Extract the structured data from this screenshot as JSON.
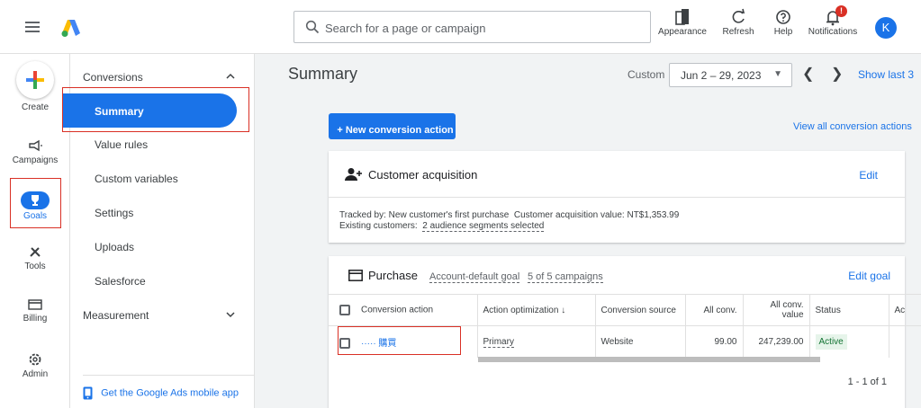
{
  "header": {
    "search_placeholder": "Search for a page or campaign",
    "tools": [
      {
        "label": "Appearance",
        "icon": "appearance-icon"
      },
      {
        "label": "Refresh",
        "icon": "refresh-icon"
      },
      {
        "label": "Help",
        "icon": "help-icon"
      },
      {
        "label": "Notifications",
        "icon": "bell-icon"
      }
    ],
    "notification_badge": "!",
    "avatar_initial": "K"
  },
  "rail": {
    "items": [
      {
        "label": "Create",
        "icon": "plus-icon"
      },
      {
        "label": "Campaigns",
        "icon": "megaphone-icon"
      },
      {
        "label": "Goals",
        "icon": "trophy-icon"
      },
      {
        "label": "Tools",
        "icon": "wrench-icon"
      },
      {
        "label": "Billing",
        "icon": "card-icon"
      },
      {
        "label": "Admin",
        "icon": "gear-icon"
      }
    ]
  },
  "subnav": {
    "conversions_label": "Conversions",
    "items": [
      "Summary",
      "Value rules",
      "Custom variables",
      "Settings",
      "Uploads",
      "Salesforce"
    ],
    "measurement_label": "Measurement",
    "mobile_app_link": "Get the Google Ads mobile app"
  },
  "main": {
    "title": "Summary",
    "date_label": "Custom",
    "date_range": "Jun 2 – 29, 2023",
    "show_last": "Show last 3",
    "new_conversion_button": "+ New conversion action",
    "view_all_link": "View all conversion actions",
    "customer_card": {
      "title": "Customer acquisition",
      "edit": "Edit",
      "tracked_by_label": "Tracked by:",
      "tracked_by_value": "New customer's first purchase",
      "acq_value_label": "Customer acquisition value:",
      "acq_value": "NT$1,353.99",
      "existing_label": "Existing customers:",
      "existing_value": "2 audience segments selected"
    },
    "purchase_card": {
      "title": "Purchase",
      "goal_type": "Account-default goal",
      "campaigns": "5 of 5 campaigns",
      "edit_goal": "Edit goal",
      "columns": [
        "Conversion action",
        "Action optimization",
        "Conversion source",
        "All conv.",
        "All conv. value",
        "Status",
        "Ac"
      ],
      "rows": [
        {
          "action": "····· 購買",
          "optimization": "Primary",
          "source": "Website",
          "all_conv": "99.00",
          "all_conv_value": "247,239.00",
          "status": "Active"
        }
      ],
      "pagination": "1 - 1 of 1"
    }
  },
  "colors": {
    "accent": "#1a73e8",
    "highlight_border": "#d93025",
    "active_green": "#137333"
  }
}
